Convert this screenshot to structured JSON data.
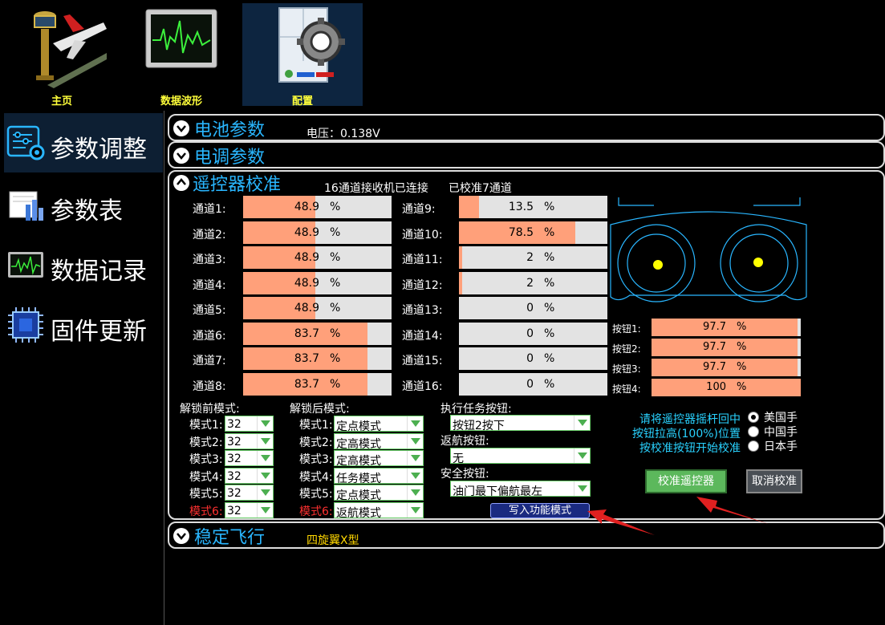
{
  "toolbar": {
    "items": [
      {
        "label": "主页",
        "icon": "airport-tower-plane-icon"
      },
      {
        "label": "数据波形",
        "icon": "waveform-monitor-icon"
      },
      {
        "label": "配置",
        "icon": "config-gear-icon"
      }
    ],
    "active": "配置"
  },
  "sidebar": {
    "items": [
      {
        "label": "参数调整",
        "icon": "sliders-gear-icon"
      },
      {
        "label": "参数表",
        "icon": "bar-table-icon"
      },
      {
        "label": "数据记录",
        "icon": "data-record-icon"
      },
      {
        "label": "固件更新",
        "icon": "chip-icon"
      }
    ],
    "active": "参数调整"
  },
  "battery": {
    "title": "电池参数",
    "voltage": "电压：0.138V"
  },
  "esc": {
    "title": "电调参数"
  },
  "rc": {
    "title": "遥控器校准",
    "status_connected": "16通道接收机已连接",
    "status_calibrated": "已校准7通道",
    "channels_left": [
      {
        "label": "通道1:",
        "value": "48.9",
        "unit": "%",
        "fraction": 0.489
      },
      {
        "label": "通道2:",
        "value": "48.9",
        "unit": "%",
        "fraction": 0.489
      },
      {
        "label": "通道3:",
        "value": "48.9",
        "unit": "%",
        "fraction": 0.489
      },
      {
        "label": "通道4:",
        "value": "48.9",
        "unit": "%",
        "fraction": 0.489
      },
      {
        "label": "通道5:",
        "value": "48.9",
        "unit": "%",
        "fraction": 0.489
      },
      {
        "label": "通道6:",
        "value": "83.7",
        "unit": "%",
        "fraction": 0.837
      },
      {
        "label": "通道7:",
        "value": "83.7",
        "unit": "%",
        "fraction": 0.837
      },
      {
        "label": "通道8:",
        "value": "83.7",
        "unit": "%",
        "fraction": 0.837
      }
    ],
    "channels_right": [
      {
        "label": "通道9:",
        "value": "13.5",
        "unit": "%",
        "fraction": 0.135
      },
      {
        "label": "通道10:",
        "value": "78.5",
        "unit": "%",
        "fraction": 0.785
      },
      {
        "label": "通道11:",
        "value": "2",
        "unit": "%",
        "fraction": 0.02
      },
      {
        "label": "通道12:",
        "value": "2",
        "unit": "%",
        "fraction": 0.02
      },
      {
        "label": "通道13:",
        "value": "0",
        "unit": "%",
        "fraction": 0
      },
      {
        "label": "通道14:",
        "value": "0",
        "unit": "%",
        "fraction": 0
      },
      {
        "label": "通道15:",
        "value": "0",
        "unit": "%",
        "fraction": 0
      },
      {
        "label": "通道16:",
        "value": "0",
        "unit": "%",
        "fraction": 0
      }
    ],
    "buttons": [
      {
        "label": "按钮1:",
        "value": "97.7",
        "unit": "%",
        "fraction": 0.977
      },
      {
        "label": "按钮2:",
        "value": "97.7",
        "unit": "%",
        "fraction": 0.977
      },
      {
        "label": "按钮3:",
        "value": "97.7",
        "unit": "%",
        "fraction": 0.977
      },
      {
        "label": "按钮4:",
        "value": "100",
        "unit": "%",
        "fraction": 1.0
      }
    ],
    "pre_unlock": {
      "title": "解锁前模式:",
      "modes": [
        {
          "label": "模式1:",
          "value": "32"
        },
        {
          "label": "模式2:",
          "value": "32"
        },
        {
          "label": "模式3:",
          "value": "32"
        },
        {
          "label": "模式4:",
          "value": "32"
        },
        {
          "label": "模式5:",
          "value": "32"
        },
        {
          "label": "模式6:",
          "value": "32"
        }
      ]
    },
    "post_unlock": {
      "title": "解锁后模式:",
      "modes": [
        {
          "label": "模式1:",
          "value": "定点模式"
        },
        {
          "label": "模式2:",
          "value": "定高模式"
        },
        {
          "label": "模式3:",
          "value": "定高模式"
        },
        {
          "label": "模式4:",
          "value": "任务模式"
        },
        {
          "label": "模式5:",
          "value": "定点模式"
        },
        {
          "label": "模式6:",
          "value": "返航模式"
        }
      ]
    },
    "task_button": {
      "title": "执行任务按钮:",
      "value": "按钮2按下"
    },
    "rth_button": {
      "title": "返航按钮:",
      "value": "无"
    },
    "safety_button": {
      "title": "安全按钮:",
      "value": "油门最下偏航最左"
    },
    "write_mode_button": "写入功能模式",
    "calib_instructions": [
      "请将遥控器摇杆回中",
      "按钮拉高(100%)位置",
      "按校准按钮开始校准"
    ],
    "hand_modes": [
      {
        "label": "美国手",
        "selected": true
      },
      {
        "label": "中国手",
        "selected": false
      },
      {
        "label": "日本手",
        "selected": false
      }
    ],
    "calibrate_button": "校准遥控器",
    "cancel_button": "取消校准"
  },
  "stable_flight": {
    "title": "稳定飞行",
    "frame": "四旋翼X型"
  },
  "colors": {
    "accent": "#29b6ff",
    "fill": "#ffa07a",
    "track": "#e3e3e3",
    "highlight_label": "#ffff3a",
    "stick_dot": "#ffff00"
  }
}
